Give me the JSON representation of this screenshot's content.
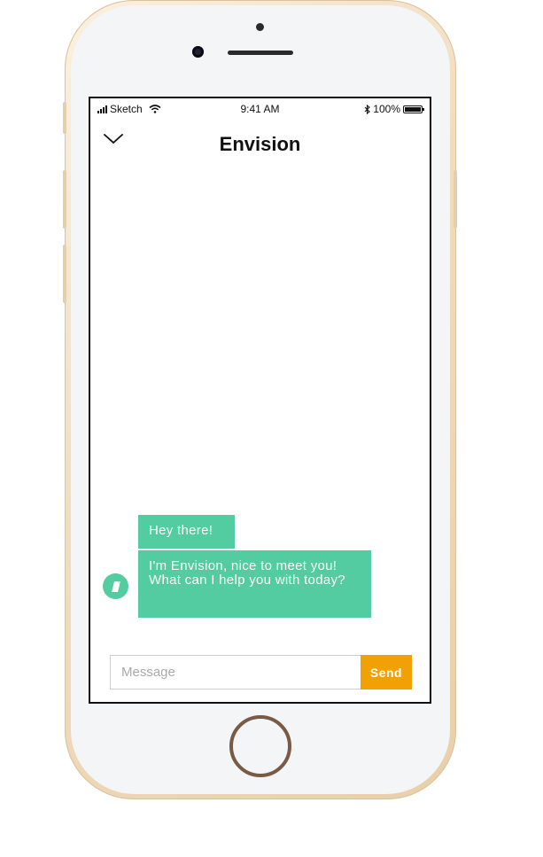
{
  "status_bar": {
    "carrier": "Sketch",
    "time": "9:41 AM",
    "battery": "100%",
    "icons": [
      "signal-icon",
      "wifi-icon",
      "bluetooth-icon",
      "battery-icon"
    ]
  },
  "header": {
    "title": "Envision",
    "back_icon": "chevron-down-icon"
  },
  "messages": [
    {
      "text": "Hey there!"
    },
    {
      "text": "I'm Envision, nice to meet you! What can I help you with today?"
    }
  ],
  "composer": {
    "placeholder": "Message",
    "value": "",
    "send_label": "Send"
  },
  "colors": {
    "bubble": "#52cca0",
    "send_button": "#f2a105",
    "phone_gold": "#f1dcbf"
  }
}
